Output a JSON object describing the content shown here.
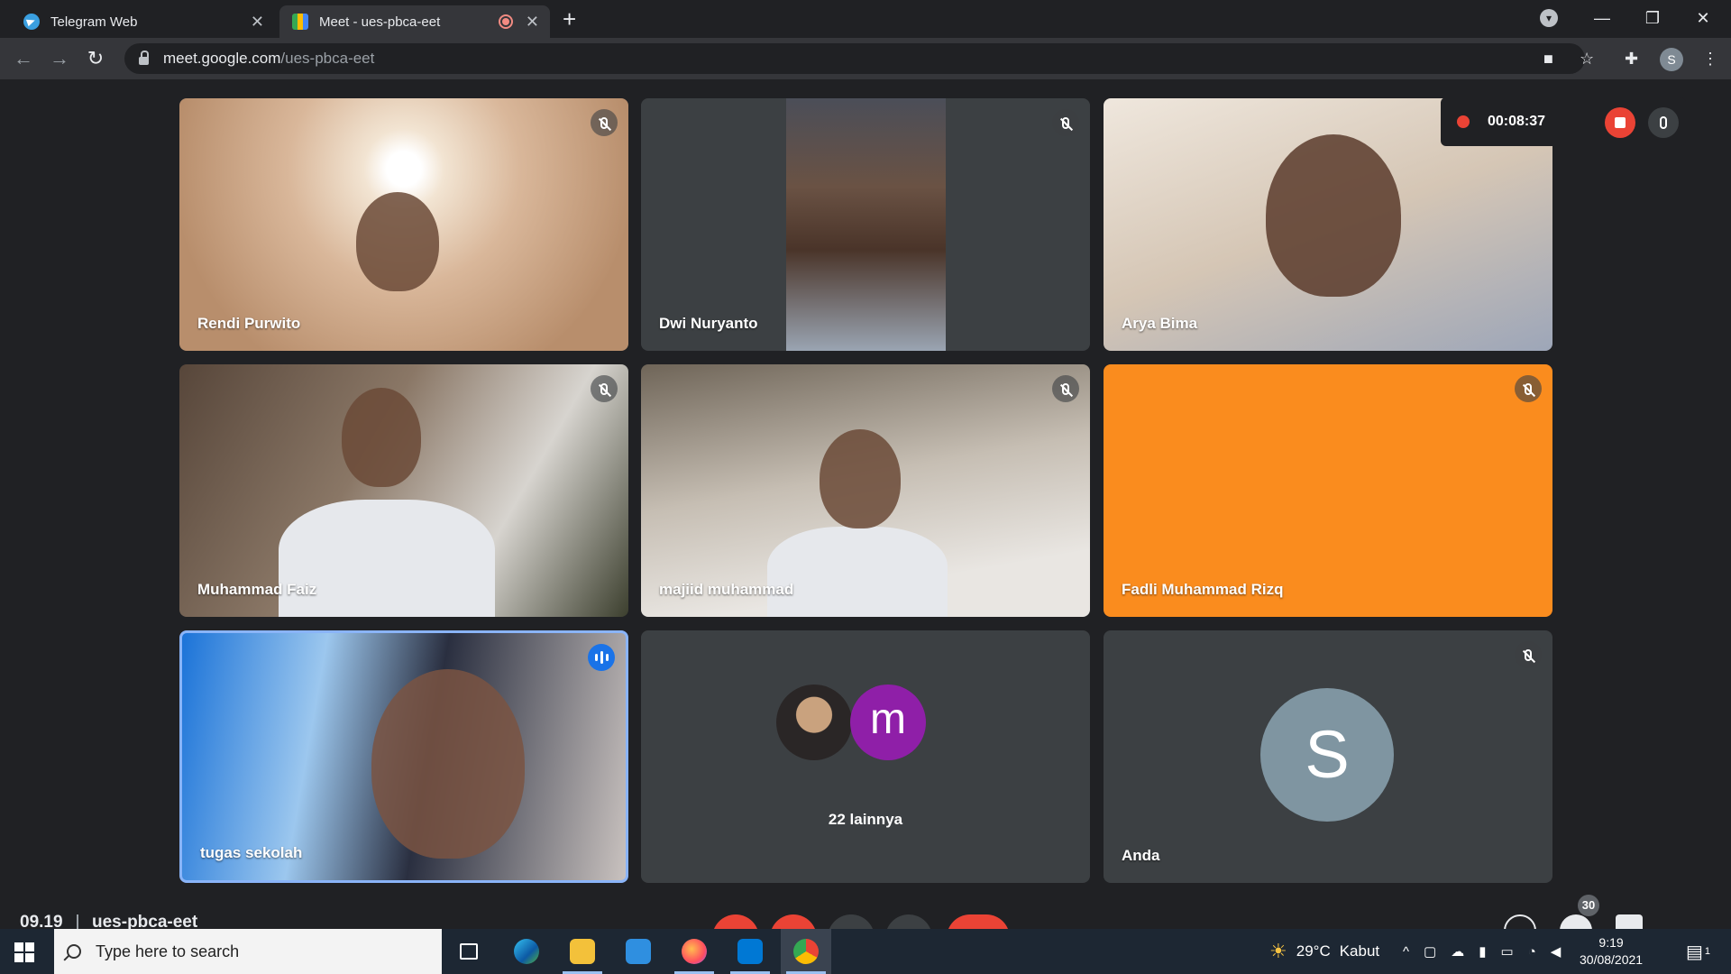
{
  "browser": {
    "tabs": [
      {
        "title": "Telegram Web",
        "active": false
      },
      {
        "title": "Meet - ues-pbca-eet",
        "active": true
      }
    ],
    "new_tab": "+",
    "url_host": "meet.google.com",
    "url_path": "/ues-pbca-eet",
    "profile_initial": "S"
  },
  "recording": {
    "time": "00:08:37"
  },
  "participants": [
    {
      "name": "Rendi Purwito",
      "muted": true
    },
    {
      "name": "Dwi Nuryanto",
      "muted": true
    },
    {
      "name": "Arya Bima",
      "muted": false
    },
    {
      "name": "Muhammad Faiz",
      "muted": true
    },
    {
      "name": "majiid muhammad",
      "muted": true
    },
    {
      "name": "Fadli Muhammad Rizq",
      "muted": true
    },
    {
      "name": "tugas sekolah",
      "speaking": true
    },
    {
      "others_avatar_letter": "m",
      "others_label": "22 lainnya"
    },
    {
      "name": "Anda",
      "avatar_letter": "S",
      "muted": true
    }
  ],
  "meeting_bar": {
    "time": "09.19",
    "code": "ues-pbca-eet",
    "participant_count": "30"
  },
  "taskbar": {
    "search_placeholder": "Type here to search",
    "weather_temp": "29°C",
    "weather_text": "Kabut",
    "clock_time": "9:19",
    "clock_date": "30/08/2021",
    "notification_count": "1"
  },
  "colors": {
    "meet_bg": "#202124",
    "tile_bg": "#3c4043",
    "orange_tile": "#fa8c1e",
    "speaking_blue": "#1a73e8",
    "record_red": "#ea4335",
    "taskbar_bg": "#1d2733"
  }
}
